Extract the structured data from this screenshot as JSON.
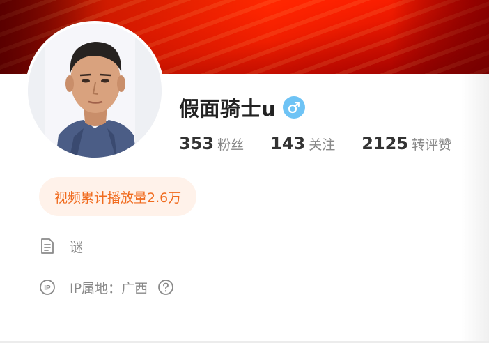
{
  "profile": {
    "username": "假面骑士u",
    "gender": "male",
    "cover_color": "#ff5a05"
  },
  "stats": [
    {
      "value": "353",
      "label": "粉丝"
    },
    {
      "value": "143",
      "label": "关注"
    },
    {
      "value": "2125",
      "label": "转评赞"
    }
  ],
  "badges": {
    "views_text": "视频累计播放量2.6万",
    "accent_color": "#f06b1e"
  },
  "info": {
    "bio": "谜",
    "ip_label": "IP属地：",
    "ip_location": "广西"
  },
  "icons": {
    "gender": "male-symbol-icon",
    "bio": "document-icon",
    "ip": "ip-icon",
    "help": "question-circle-icon"
  }
}
